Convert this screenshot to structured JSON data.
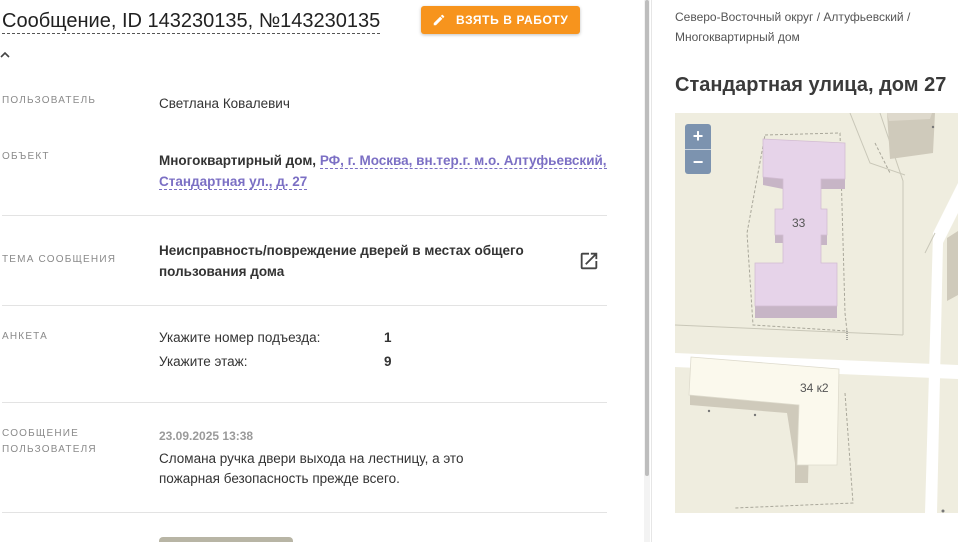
{
  "header": {
    "title": "Сообщение, ID 143230135, №143230135",
    "take_button_label": "ВЗЯТЬ В РАБОТУ"
  },
  "fields": {
    "user": {
      "label": "ПОЛЬЗОВАТЕЛЬ",
      "value": "Светлана Ковалевич"
    },
    "object": {
      "label": "ОБЪЕКТ",
      "type": "Многоквартирный дом,",
      "address_line1": "РФ, г. Москва, вн.тер.г. м.о. Алтуфьевский,",
      "address_line2": "Стандартная ул., д. 27"
    },
    "topic": {
      "label": "ТЕМА СООБЩЕНИЯ",
      "line1": "Неисправность/повреждение дверей в местах общего",
      "line2": "пользования дома"
    },
    "survey": {
      "label": "АНКЕТА",
      "rows": [
        {
          "question": "Укажите номер подъезда:",
          "answer": "1"
        },
        {
          "question": "Укажите этаж:",
          "answer": "9"
        }
      ]
    },
    "message": {
      "label_line1": "СООБЩЕНИЕ",
      "label_line2": "ПОЛЬЗОВАТЕЛЯ",
      "date": "23.09.2025 13:38",
      "text": "Сломана ручка двери выхода на лестницу, а это пожарная безопасность прежде всего."
    }
  },
  "sidebar": {
    "breadcrumb_line1": "Северо-Восточный округ / Алтуфьевский /",
    "breadcrumb_line2": "Многоквартирный дом",
    "address_title": "Стандартная улица, дом 27",
    "map": {
      "zoom_in": "+",
      "zoom_out": "−",
      "building_main": "33",
      "building_second": "34 к2"
    }
  },
  "colors": {
    "accent_orange": "#f7941d",
    "link_purple": "#7b6fc4",
    "map_building_highlight": "#e6d3e9"
  }
}
